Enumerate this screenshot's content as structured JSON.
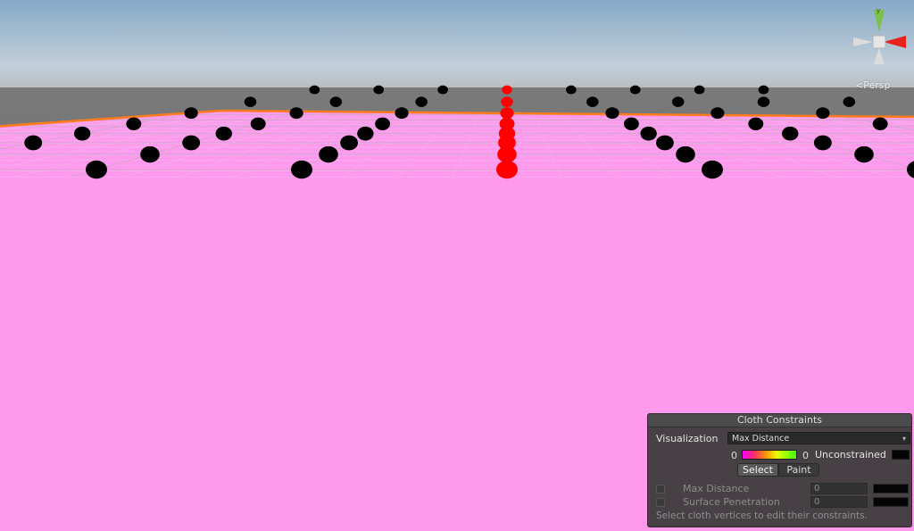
{
  "scene": {
    "view_mode": "Persp",
    "sky_top": "#86a9c6",
    "sky_bottom": "#c9d4dc",
    "ground_color": "#6a6a6a",
    "cloth_color": "#ff99ee",
    "cloth_outline": "#ff7a1a",
    "grid_line": "#d8a8d4",
    "vertex_default_color": "#000000",
    "vertex_selected_color": "#ff0000",
    "vertex_count": 64
  },
  "gizmo": {
    "y_axis_color": "#7cc04a",
    "x_axis_color": "#e8231b",
    "neutral_color": "#d9d9d9"
  },
  "panel": {
    "title": "Cloth Constraints",
    "visualization_label": "Visualization",
    "visualization_value": "Max Distance",
    "gradient_min": "0",
    "gradient_max": "0",
    "unconstrained_label": "Unconstrained",
    "select_label": "Select",
    "paint_label": "Paint",
    "max_distance_label": "Max Distance",
    "max_distance_value": "0",
    "surface_penetration_label": "Surface Penetration",
    "surface_penetration_value": "0",
    "hint": "Select cloth vertices to edit their constraints."
  }
}
